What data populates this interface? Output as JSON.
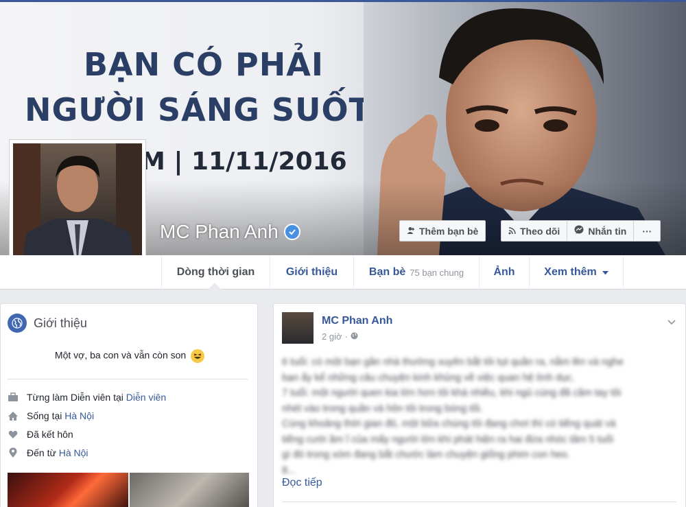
{
  "cover": {
    "headline_line1": "BẠN CÓ PHẢI",
    "headline_line2": "NGƯỜI SÁNG SUỐT?",
    "date_line": "M | 11/11/2016"
  },
  "profile": {
    "name": "MC Phan Anh",
    "buttons": {
      "add_friend": "Thêm bạn bè",
      "follow": "Theo dõi",
      "message": "Nhắn tin",
      "more": "···"
    }
  },
  "nav": {
    "tabs": [
      {
        "label": "Dòng thời gian"
      },
      {
        "label": "Giới thiệu"
      },
      {
        "label": "Bạn bè",
        "sub": "75 bạn chung"
      },
      {
        "label": "Ảnh"
      },
      {
        "label": "Xem thêm"
      }
    ]
  },
  "intro": {
    "title": "Giới thiệu",
    "bio": "Một vợ, ba con và vẫn còn son",
    "bio_emoji": "😆",
    "rows": [
      {
        "icon": "briefcase-icon",
        "text": "Từng làm Diễn viên tại ",
        "link": "Diễn viên"
      },
      {
        "icon": "home-icon",
        "text": "Sống tại ",
        "link": "Hà Nội"
      },
      {
        "icon": "heart-icon",
        "text": "Đã kết hôn",
        "link": ""
      },
      {
        "icon": "location-pin-icon",
        "text": "Đến từ ",
        "link": "Hà Nội"
      }
    ]
  },
  "post": {
    "author": "MC Phan Anh",
    "time": "2 giờ",
    "separator": "·",
    "body_lines": [
      "6 tuổi: có một bạn gần nhà thường xuyên bắt tôi tụt quần ra, nằm lên và nghe",
      "bạn ấy kể những câu chuyện kinh khủng về việc quan hệ tình dục.",
      "7 tuổi: một người quen kia lớn hơn tôi khá nhiều, khi ngủ cùng đã cầm tay tôi",
      "nhét vào trong quần và hôn tôi trong bóng tối.",
      "Cùng khoảng thời gian đó, một bữa chúng tôi đang chơi thì có tiếng quát và",
      "tiếng cười ầm ĩ của mấy người lớn khi phát hiện ra hai đứa nhóc tầm 5 tuổi",
      "gì đó trong xóm đang bắt chước làm chuyện giống phim con heo.",
      "8..."
    ],
    "read_more": "Đọc tiếp"
  },
  "colors": {
    "brand": "#3b5998",
    "link": "#365899",
    "background": "#e9ebee"
  }
}
